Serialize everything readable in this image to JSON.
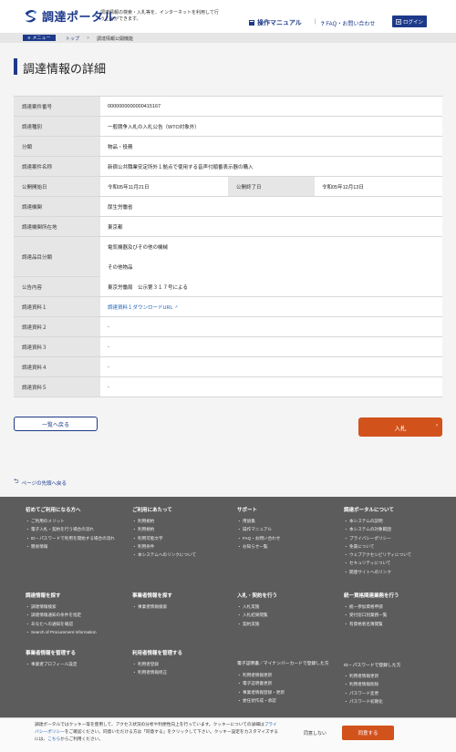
{
  "header": {
    "logo_text": "調達ポータル",
    "tagline": "調達情報の検索・入札等を、インターネットを利用して行うことができます。",
    "manual_label": "操作マニュアル",
    "faq_label": "FAQ・お問い合わせ",
    "login_label": "ログイン"
  },
  "breadcrumb": {
    "menu_label": "メニュー",
    "items": [
      "トップ",
      "調達情報公開機能"
    ]
  },
  "page_title": "調達情報の詳細",
  "details": {
    "case_no_label": "調達案件番号",
    "case_no": "0000000000000415167",
    "type_label": "調達種別",
    "type": "一般競争入札の入札公告（WTO対象外）",
    "category_label": "分類",
    "category": "物品・役務",
    "name_label": "調達案件名称",
    "name": "新宿公共職業安定所外１拠点で使用する音声付順番表示器の購入",
    "pub_start_label": "公開開始日",
    "pub_start": "令和05年11月21日",
    "pub_end_label": "公開終了日",
    "pub_end": "令和05年12月13日",
    "org_label": "調達機関",
    "org": "厚生労働省",
    "org_location_label": "調達機関所在地",
    "org_location": "東京都",
    "item_category_label": "調達品目分類",
    "item_category_1": "電気機器及びその他の機械",
    "item_category_2": "その他物品",
    "notice_label": "公告内容",
    "notice": "東京労働局　公示第３１７号による",
    "doc1_label": "調達資料１",
    "doc1": "調達資料１ダウンロードURL",
    "doc2_label": "調達資料２",
    "doc2": "-",
    "doc3_label": "調達資料３",
    "doc3": "-",
    "doc4_label": "調達資料４",
    "doc4": "-",
    "doc5_label": "調達資料５",
    "doc5": "-"
  },
  "buttons": {
    "back": "一覧へ戻る",
    "bid": "入札"
  },
  "to_top": "ページの先頭へ戻る",
  "footer": {
    "col1": {
      "title": "初めてご利用になる方へ",
      "items": [
        "ご利用のメリット",
        "電子入札・契約を行う場合の流れ",
        "ID・パスワードで利用を開始する場合の流れ",
        "簡易情報"
      ]
    },
    "col2": {
      "title": "ご利用にあたって",
      "items": [
        "利用規約",
        "利用規約",
        "利用可能文字",
        "利用条件",
        "本システムへのリンクについて"
      ]
    },
    "col3": {
      "title": "サポート",
      "items": [
        "用語集",
        "操作マニュアル",
        "FAQ・お問い合わせ",
        "お知らせ一覧"
      ]
    },
    "col4": {
      "title": "調達ポータルについて",
      "items": [
        "本システムの説明",
        "本システムの対象範囲",
        "プライバシーポリシー",
        "免責について",
        "ウェブアクセシビリティについて",
        "セキュリティについて",
        "関連サイトへのリンク"
      ]
    },
    "col5": {
      "title": "調達情報を探す",
      "items": [
        "調達情報検索",
        "調達情報通知の条件を指定",
        "あなたへの通知を確認",
        "Search of Procurement Information"
      ]
    },
    "col6": {
      "title": "事業者情報を探す",
      "items": [
        "事業者情報検索"
      ]
    },
    "col7": {
      "title": "入札・契約を行う",
      "items": [
        "入札実施",
        "入札結果閲覧",
        "契約実施"
      ]
    },
    "col8": {
      "title": "統一資格関連業務を行う",
      "items": [
        "統一参加資格申請",
        "受付窓口別業務一覧",
        "有資格者名簿閲覧"
      ]
    },
    "col9": {
      "title": "事業者情報を管理する",
      "items": [
        "事業者プロフィール設定"
      ]
    },
    "col10": {
      "title": "利用者情報を管理する",
      "items": [
        "利用者登録",
        "利用者情報修正"
      ]
    },
    "col11": {
      "title": "電子証明書／マイナンバーカードで登録した方",
      "items": [
        "利用者情報更新",
        "電子証明書更新",
        "事業者情報登録・更新",
        "委任状作成・承認"
      ]
    },
    "col12": {
      "title": "ID・パスワードで登録した方",
      "items": [
        "利用者情報更新",
        "利用者情報削除",
        "パスワード変更",
        "パスワード初期化"
      ]
    }
  },
  "cookie": {
    "text_a": "調達ポータルではクッキー等を使用して、アクセス状況の分析や利便性向上を行っています。クッキーについての詳細は",
    "link_privacy": "プライバシーポリシー",
    "text_b": "をご確認ください。同意いただける方は「同意する」をクリックして下さい。クッキー設定をカスタマイズするには、",
    "link_here": "こちら",
    "text_c": "からご利用ください。",
    "deny": "同意しない",
    "agree": "同意する"
  },
  "colors": {
    "brand": "#1d3a8a",
    "accent": "#d2521c",
    "footer": "#5c5c5c"
  }
}
